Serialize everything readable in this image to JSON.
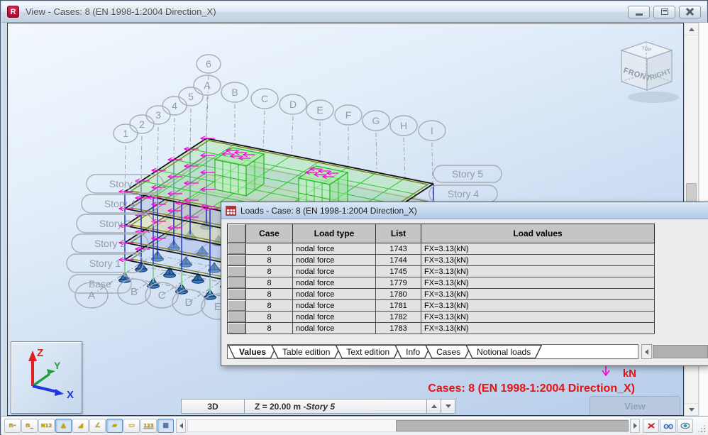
{
  "window": {
    "title": "View - Cases: 8 (EN 1998-1:2004 Direction_X)",
    "app_icon_letter": "R"
  },
  "scene": {
    "grid_numbers": [
      "1",
      "2",
      "3",
      "4",
      "5",
      "6"
    ],
    "grid_letters": [
      "A",
      "B",
      "C",
      "D",
      "E",
      "F",
      "G",
      "H",
      "I"
    ],
    "stories_left": [
      "Story 5",
      "Story 4",
      "Story 3",
      "Story 2",
      "Story 1",
      "Base"
    ],
    "stories_right": [
      "Story 5",
      "Story 4"
    ],
    "base_letters": [
      "A",
      "B",
      "C",
      "D",
      "E"
    ],
    "view_cube": {
      "front": "FRONT",
      "right": "RIGHT",
      "top": "TOP"
    },
    "axis_triad": {
      "x": "X",
      "y": "Y",
      "z": "Z"
    },
    "unit_label": "kN",
    "case_annotation": "Cases: 8 (EN 1998-1:2004 Direction_X)"
  },
  "status_bar": {
    "mode": "3D",
    "level_prefix": "Z = 20.00 m - ",
    "level_story": "Story 5",
    "view_tab_label": "View"
  },
  "loads_window": {
    "title": "Loads - Case: 8 (EN 1998-1:2004 Direction_X)",
    "columns": [
      "Case",
      "Load type",
      "List",
      "Load values"
    ],
    "rows": [
      {
        "case": "8",
        "load_type": "nodal force",
        "list": "1743",
        "load_values": "FX=3.13(kN)"
      },
      {
        "case": "8",
        "load_type": "nodal force",
        "list": "1744",
        "load_values": "FX=3.13(kN)"
      },
      {
        "case": "8",
        "load_type": "nodal force",
        "list": "1745",
        "load_values": "FX=3.13(kN)"
      },
      {
        "case": "8",
        "load_type": "nodal force",
        "list": "1779",
        "load_values": "FX=3.13(kN)"
      },
      {
        "case": "8",
        "load_type": "nodal force",
        "list": "1780",
        "load_values": "FX=3.13(kN)"
      },
      {
        "case": "8",
        "load_type": "nodal force",
        "list": "1781",
        "load_values": "FX=3.13(kN)"
      },
      {
        "case": "8",
        "load_type": "nodal force",
        "list": "1782",
        "load_values": "FX=3.13(kN)"
      },
      {
        "case": "8",
        "load_type": "nodal force",
        "list": "1783",
        "load_values": "FX=3.13(kN)"
      }
    ],
    "tabs": [
      "Values",
      "Table edition",
      "Text edition",
      "Info",
      "Cases",
      "Notional loads"
    ],
    "active_tab": "Values"
  },
  "toolbar": {
    "buttons": [
      {
        "name": "node-numbers",
        "glyph": "n-"
      },
      {
        "name": "bar-numbers",
        "glyph": "n_"
      },
      {
        "name": "panel-numbers",
        "glyph": "N12"
      },
      {
        "name": "supports",
        "glyph": "▲"
      },
      {
        "name": "section-shapes",
        "glyph": "◢"
      },
      {
        "name": "profiles",
        "glyph": "∠"
      },
      {
        "name": "panels",
        "glyph": "▰"
      },
      {
        "name": "walls",
        "glyph": "▭"
      },
      {
        "name": "load-symbols",
        "glyph": "123"
      },
      {
        "name": "panel-colors",
        "glyph": "▦"
      }
    ]
  },
  "colors": {
    "annotation_red": "#e81010",
    "load_magenta": "#ff00dd",
    "structure_green": "#28c828",
    "roof_fill": "#b0e8b0",
    "column_blue": "#2a35cc",
    "support_blue": "#2f6fae",
    "titlebar_blue": "#c2d2e2"
  }
}
